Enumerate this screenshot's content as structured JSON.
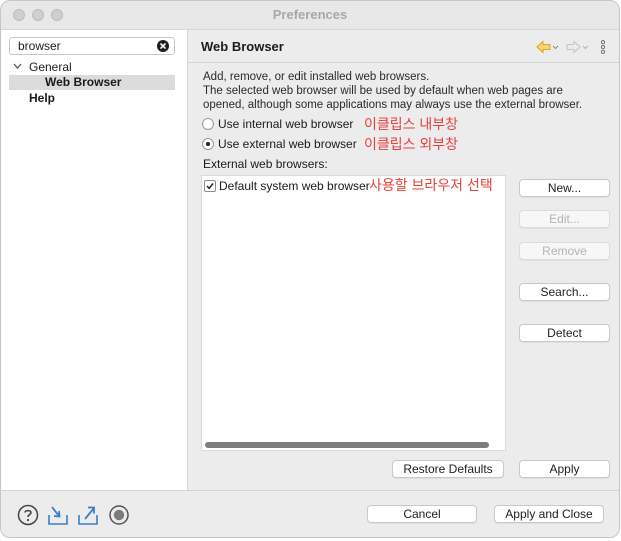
{
  "window": {
    "title": "Preferences"
  },
  "sidebar": {
    "search_value": "browser",
    "tree": {
      "general": "General",
      "web_browser": "Web Browser",
      "help": "Help"
    }
  },
  "panel": {
    "title": "Web Browser",
    "description": [
      "Add, remove, or edit installed web browsers.",
      "The selected web browser will be used by default when web pages are",
      "opened, although some applications may always use the external browser."
    ],
    "radio_internal": "Use internal web browser",
    "radio_external": "Use external web browser",
    "selected_radio": "external",
    "ext_list_label": "External web browsers:",
    "browsers": [
      {
        "label": "Default system web browser",
        "checked": true
      }
    ],
    "buttons": {
      "new": "New...",
      "edit": "Edit...",
      "remove": "Remove",
      "search": "Search...",
      "detect": "Detect",
      "restore_defaults": "Restore Defaults",
      "apply": "Apply"
    }
  },
  "annotations": {
    "internal": "이클립스 내부창",
    "external": "이클립스 외부창",
    "browser_choice": "사용할 브라우저 선택"
  },
  "footer": {
    "cancel": "Cancel",
    "apply_and_close": "Apply and Close"
  },
  "colors": {
    "annotation": "#e8413b",
    "nav_back_arrow": "#e0a419"
  },
  "icons": [
    "search-clear-icon",
    "chevron-down-icon",
    "back-arrow-icon",
    "forward-arrow-icon",
    "view-menu-icon",
    "help-icon",
    "import-icon",
    "export-icon",
    "record-icon"
  ]
}
